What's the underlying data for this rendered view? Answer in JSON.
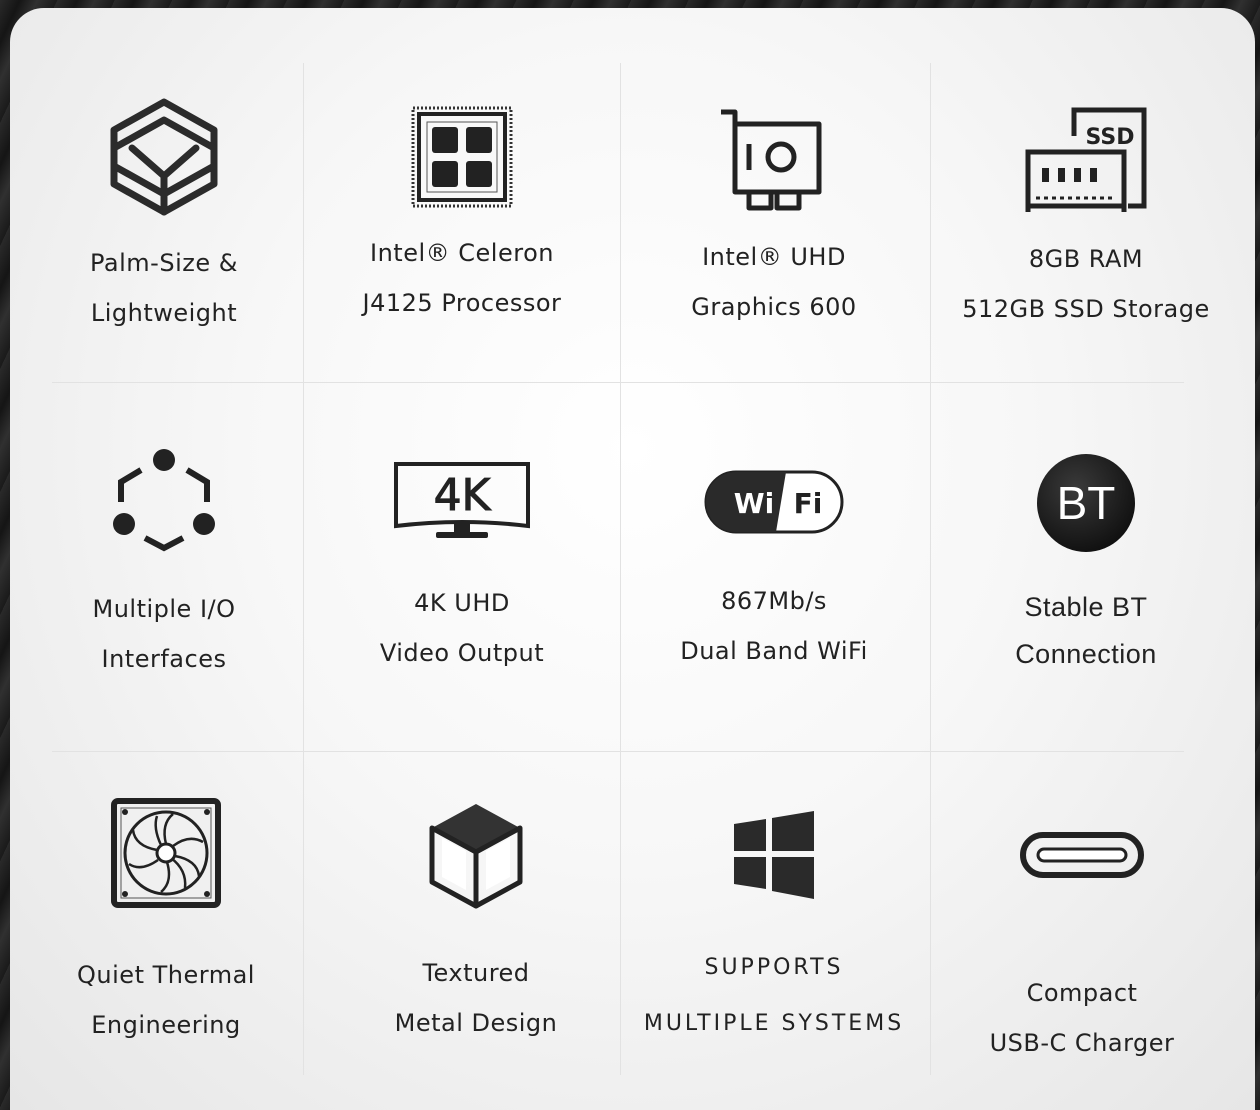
{
  "features": [
    {
      "icon": "palm-size-cube-icon",
      "lines": [
        "Palm-Size &",
        "Lightweight"
      ]
    },
    {
      "icon": "cpu-chip-icon",
      "lines": [
        "Intel® Celeron",
        "J4125 Processor"
      ]
    },
    {
      "icon": "graphics-card-icon",
      "lines": [
        "Intel® UHD",
        "Graphics 600"
      ]
    },
    {
      "icon": "ram-ssd-icon",
      "badge": "SSD",
      "lines": [
        "8GB RAM",
        "512GB SSD Storage"
      ]
    },
    {
      "icon": "io-interfaces-icon",
      "lines": [
        "Multiple I/O",
        "Interfaces"
      ]
    },
    {
      "icon": "4k-monitor-icon",
      "badge": "4K",
      "lines": [
        "4K UHD",
        "Video Output"
      ]
    },
    {
      "icon": "wifi-badge-icon",
      "badge_left": "Wi",
      "badge_right": "Fi",
      "lines": [
        "867Mb/s",
        "Dual Band WiFi"
      ]
    },
    {
      "icon": "bluetooth-badge-icon",
      "badge": "BT",
      "lines": [
        "Stable BT",
        "Connection"
      ]
    },
    {
      "icon": "cooling-fan-icon",
      "lines": [
        "Quiet Thermal",
        "Engineering"
      ]
    },
    {
      "icon": "metal-cube-icon",
      "lines": [
        "Textured",
        "Metal Design"
      ]
    },
    {
      "icon": "windows-logo-icon",
      "lines": [
        "SUPPORTS",
        "MULTIPLE SYSTEMS"
      ]
    },
    {
      "icon": "usb-c-port-icon",
      "lines": [
        "Compact",
        "USB-C Charger"
      ]
    }
  ]
}
